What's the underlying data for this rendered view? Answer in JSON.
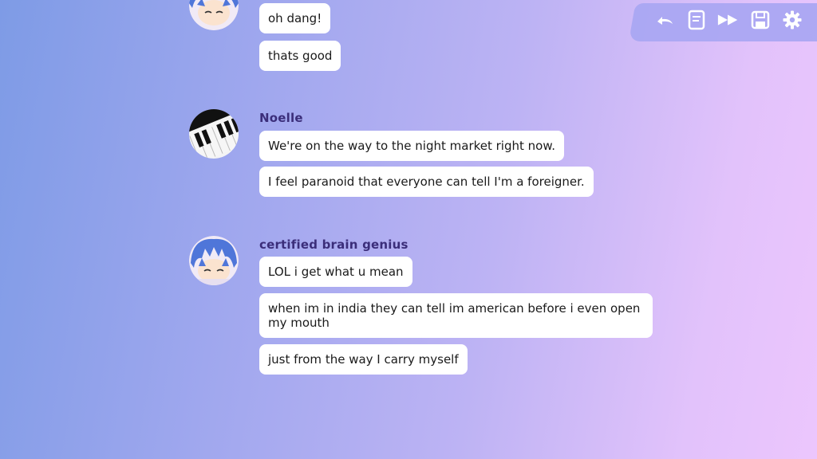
{
  "toolbar": {
    "icons": [
      "back-icon",
      "log-icon",
      "skip-icon",
      "save-icon",
      "settings-icon"
    ]
  },
  "chat": {
    "group1": {
      "messages": [
        "oh dang!",
        "thats good"
      ]
    },
    "group2": {
      "name": "Noelle",
      "messages": [
        "We're on the way to the night market right now.",
        "I feel paranoid that everyone can tell I'm a foreigner."
      ]
    },
    "group3": {
      "name": "certified brain genius",
      "messages": [
        "LOL i get what u mean",
        "when im in india they can tell im american before i even open\nmy mouth",
        "just from the way I carry myself"
      ]
    }
  },
  "colors": {
    "name": "#3b2e7a",
    "bubble": "#ffffff",
    "toolbar": "#a8a6f2"
  }
}
